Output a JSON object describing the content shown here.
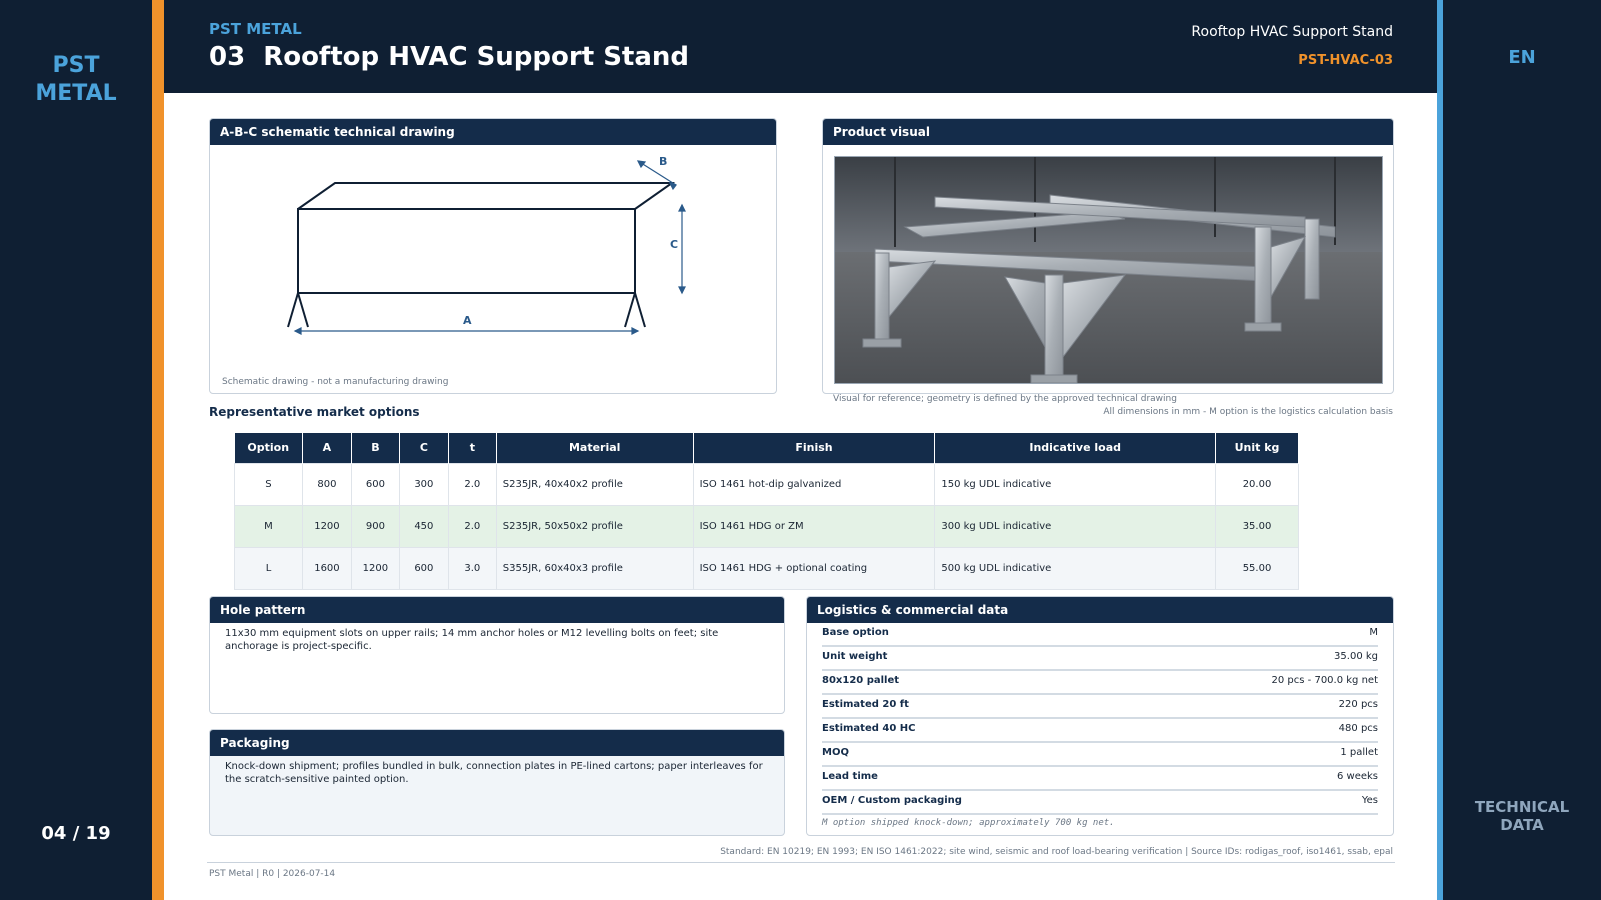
{
  "brand": {
    "line1": "PST",
    "line2": "METAL",
    "small": "PST METAL"
  },
  "page": {
    "number": "03",
    "title": "Rooftop HVAC Support Stand",
    "counter": "04 / 19"
  },
  "header_right": {
    "title": "Rooftop HVAC Support Stand",
    "code": "PST-HVAC-03"
  },
  "language": "EN",
  "section_tag": {
    "line1": "TECHNICAL",
    "line2": "DATA"
  },
  "drawing": {
    "heading": "A-B-C schematic technical drawing",
    "label_a": "A",
    "label_b": "B",
    "label_c": "C",
    "note": "Schematic drawing - not a manufacturing drawing"
  },
  "visual": {
    "heading": "Product visual",
    "caption": "Visual for reference; geometry is defined by the approved technical drawing"
  },
  "dims_note": "All dimensions in mm - M option is the logistics calculation basis",
  "options": {
    "heading": "Representative market options",
    "columns": [
      "Option",
      "A",
      "B",
      "C",
      "t",
      "Material",
      "Finish",
      "Indicative load",
      "Unit kg"
    ],
    "rows": [
      [
        "S",
        "800",
        "600",
        "300",
        "2.0",
        "S235JR, 40x40x2 profile",
        "ISO 1461 hot-dip galvanized",
        "150 kg UDL indicative",
        "20.00"
      ],
      [
        "M",
        "1200",
        "900",
        "450",
        "2.0",
        "S235JR, 50x50x2 profile",
        "ISO 1461 HDG or ZM",
        "300 kg UDL indicative",
        "35.00"
      ],
      [
        "L",
        "1600",
        "1200",
        "600",
        "3.0",
        "S355JR, 60x40x3 profile",
        "ISO 1461 HDG + optional coating",
        "500 kg UDL indicative",
        "55.00"
      ]
    ]
  },
  "hole_pattern": {
    "heading": "Hole pattern",
    "text": "11x30 mm equipment slots on upper rails; 14 mm anchor holes or M12 levelling bolts on feet; site anchorage is project-specific."
  },
  "packaging": {
    "heading": "Packaging",
    "text": "Knock-down shipment; profiles bundled in bulk, connection plates in PE-lined cartons; paper interleaves for the scratch-sensitive painted option."
  },
  "logistics": {
    "heading": "Logistics & commercial data",
    "rows": [
      {
        "key": "Base option",
        "value": "M"
      },
      {
        "key": "Unit weight",
        "value": "35.00 kg"
      },
      {
        "key": "80x120 pallet",
        "value": "20 pcs - 700.0 kg net"
      },
      {
        "key": "Estimated 20 ft",
        "value": "220 pcs"
      },
      {
        "key": "Estimated 40 HC",
        "value": "480 pcs"
      },
      {
        "key": "MOQ",
        "value": "1 pallet"
      },
      {
        "key": "Lead time",
        "value": "6 weeks"
      },
      {
        "key": "OEM / Custom packaging",
        "value": "Yes"
      }
    ],
    "note": "M option shipped knock-down; approximately 700 kg net."
  },
  "standard": "Standard: EN 10219; EN 1993; EN ISO 1461:2022; site wind, seismic and roof load-bearing verification | Source IDs: rodigas_roof, iso1461, ssab, epal",
  "footer": "PST Metal | R0 | 2026-07-14",
  "colors": {
    "navy": "#0f1f33",
    "header_navy": "#142c4a",
    "accent_orange": "#f0922b",
    "accent_blue": "#4ba3db",
    "highlight_green": "#e4f2e6"
  }
}
